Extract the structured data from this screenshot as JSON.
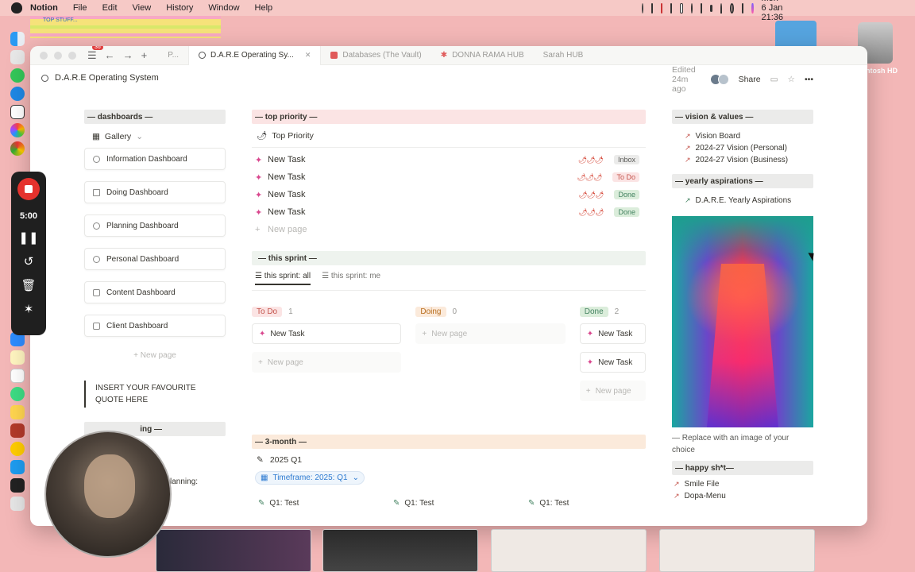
{
  "menubar": {
    "app": "Notion",
    "items": [
      "File",
      "Edit",
      "View",
      "History",
      "Window",
      "Help"
    ],
    "clock": "Mon 6 Jan  21:36"
  },
  "sticky_note": {
    "text": "TOP STUFF..."
  },
  "desktop": {
    "drive_label": "ntosh HD"
  },
  "recorder": {
    "time": "5:00"
  },
  "tabs": [
    {
      "label": "P...",
      "active": false
    },
    {
      "label": "D.A.R.E Operating Sy...",
      "active": true
    },
    {
      "label": "Databases (The Vault)",
      "active": false
    },
    {
      "label": "DONNA RAMA HUB",
      "active": false
    },
    {
      "label": "Sarah HUB",
      "active": false
    }
  ],
  "notifications": {
    "count": "36"
  },
  "topbar": {
    "title": "D.A.R.E Operating System",
    "edited": "Edited 24m ago",
    "share": "Share"
  },
  "left": {
    "heading": "— dashboards —",
    "view": "Gallery",
    "cards": [
      {
        "label": "Information Dashboard"
      },
      {
        "label": "Doing Dashboard"
      },
      {
        "label": "Planning Dashboard"
      },
      {
        "label": "Personal Dashboard"
      },
      {
        "label": "Content Dashboard"
      },
      {
        "label": "Client Dashboard"
      }
    ],
    "new_page": "New page",
    "quote": "INSERT YOUR FAVOURITE QUOTE HERE",
    "hidden_heading_tail": "ing —",
    "hidden_text_tail": "lanning:"
  },
  "middle": {
    "priority_heading": "— top priority —",
    "priority_view": "Top Priority",
    "tasks": [
      {
        "name": "New Task",
        "rating": "🌶🌶🌶",
        "status": "Inbox",
        "style": "gray"
      },
      {
        "name": "New Task",
        "rating": "🌶🌶🌶",
        "status": "To Do",
        "style": "red"
      },
      {
        "name": "New Task",
        "rating": "🌶🌶🌶",
        "status": "Done",
        "style": "green"
      },
      {
        "name": "New Task",
        "rating": "🌶🌶🌶",
        "status": "Done",
        "style": "green"
      }
    ],
    "new_page": "New page",
    "sprint_heading": "— this sprint —",
    "sprint_tabs": [
      "this sprint: all",
      "this sprint: me"
    ],
    "board": [
      {
        "label": "To Do",
        "count": "1",
        "style": "red",
        "cards": [
          "New Task"
        ],
        "new": "New page"
      },
      {
        "label": "Doing",
        "count": "0",
        "style": "orange",
        "cards": [],
        "new": "New page"
      },
      {
        "label": "Done",
        "count": "2",
        "style": "green",
        "cards": [
          "New Task",
          "New Task"
        ],
        "new": "New page"
      }
    ],
    "quarter_heading": "— 3-month —",
    "quarter_title": "2025 Q1",
    "timeframe": "Timeframe: 2025: Q1",
    "quarter_cards": [
      "Q1: Test",
      "Q1: Test",
      "Q1: Test"
    ]
  },
  "right": {
    "vision_heading": "— vision & values —",
    "vision_links": [
      "Vision Board",
      "2024-27 Vision (Personal)",
      "2024-27 Vision (Business)"
    ],
    "yearly_heading": "— yearly aspirations —",
    "yearly_link": "D.A.R.E. Yearly Aspirations",
    "caption": "— Replace with an image of your choice",
    "happy_heading": "— happy sh*t—",
    "happy_links": [
      "Smile File",
      "Dopa-Menu"
    ]
  },
  "colors": {
    "desktop": "#f3b7b7",
    "accent_red": "#e03e3e",
    "priority_band": "#fbe4e4",
    "sprint_band": "#eef3ee",
    "quarter_band": "#fbeadb"
  }
}
